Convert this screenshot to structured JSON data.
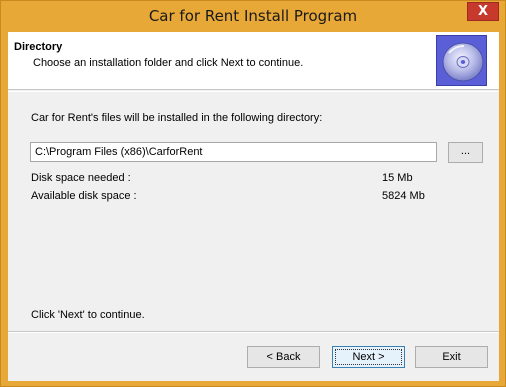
{
  "window": {
    "title": "Car for Rent Install Program",
    "close_glyph": "X"
  },
  "header": {
    "title": "Directory",
    "subtitle": "Choose an installation folder and click Next to continue.",
    "icon": "cd-disc-icon"
  },
  "main": {
    "intro": "Car for Rent's files will be installed in the following directory:",
    "path_value": "C:\\Program Files (x86)\\CarforRent",
    "browse_label": "...",
    "disk_needed_label": "Disk space needed :",
    "disk_needed_value": "15 Mb",
    "disk_available_label": "Available disk space :",
    "disk_available_value": "5824 Mb",
    "footnote": "Click 'Next' to continue."
  },
  "buttons": {
    "back": "< Back",
    "next": "Next >",
    "exit": "Exit"
  },
  "colors": {
    "titlebar": "#e8a838",
    "close": "#c7392c",
    "client": "#f0f0f0",
    "icon_bg": "#5a5fd8"
  }
}
